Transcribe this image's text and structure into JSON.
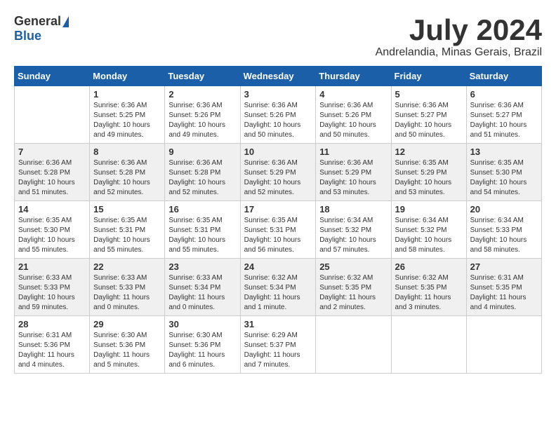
{
  "header": {
    "logo_general": "General",
    "logo_blue": "Blue",
    "month_title": "July 2024",
    "location": "Andrelandia, Minas Gerais, Brazil"
  },
  "weekdays": [
    "Sunday",
    "Monday",
    "Tuesday",
    "Wednesday",
    "Thursday",
    "Friday",
    "Saturday"
  ],
  "weeks": [
    [
      {
        "day": "",
        "sunrise": "",
        "sunset": "",
        "daylight": ""
      },
      {
        "day": "1",
        "sunrise": "Sunrise: 6:36 AM",
        "sunset": "Sunset: 5:25 PM",
        "daylight": "Daylight: 10 hours and 49 minutes."
      },
      {
        "day": "2",
        "sunrise": "Sunrise: 6:36 AM",
        "sunset": "Sunset: 5:26 PM",
        "daylight": "Daylight: 10 hours and 49 minutes."
      },
      {
        "day": "3",
        "sunrise": "Sunrise: 6:36 AM",
        "sunset": "Sunset: 5:26 PM",
        "daylight": "Daylight: 10 hours and 50 minutes."
      },
      {
        "day": "4",
        "sunrise": "Sunrise: 6:36 AM",
        "sunset": "Sunset: 5:26 PM",
        "daylight": "Daylight: 10 hours and 50 minutes."
      },
      {
        "day": "5",
        "sunrise": "Sunrise: 6:36 AM",
        "sunset": "Sunset: 5:27 PM",
        "daylight": "Daylight: 10 hours and 50 minutes."
      },
      {
        "day": "6",
        "sunrise": "Sunrise: 6:36 AM",
        "sunset": "Sunset: 5:27 PM",
        "daylight": "Daylight: 10 hours and 51 minutes."
      }
    ],
    [
      {
        "day": "7",
        "sunrise": "Sunrise: 6:36 AM",
        "sunset": "Sunset: 5:28 PM",
        "daylight": "Daylight: 10 hours and 51 minutes."
      },
      {
        "day": "8",
        "sunrise": "Sunrise: 6:36 AM",
        "sunset": "Sunset: 5:28 PM",
        "daylight": "Daylight: 10 hours and 52 minutes."
      },
      {
        "day": "9",
        "sunrise": "Sunrise: 6:36 AM",
        "sunset": "Sunset: 5:28 PM",
        "daylight": "Daylight: 10 hours and 52 minutes."
      },
      {
        "day": "10",
        "sunrise": "Sunrise: 6:36 AM",
        "sunset": "Sunset: 5:29 PM",
        "daylight": "Daylight: 10 hours and 52 minutes."
      },
      {
        "day": "11",
        "sunrise": "Sunrise: 6:36 AM",
        "sunset": "Sunset: 5:29 PM",
        "daylight": "Daylight: 10 hours and 53 minutes."
      },
      {
        "day": "12",
        "sunrise": "Sunrise: 6:35 AM",
        "sunset": "Sunset: 5:29 PM",
        "daylight": "Daylight: 10 hours and 53 minutes."
      },
      {
        "day": "13",
        "sunrise": "Sunrise: 6:35 AM",
        "sunset": "Sunset: 5:30 PM",
        "daylight": "Daylight: 10 hours and 54 minutes."
      }
    ],
    [
      {
        "day": "14",
        "sunrise": "Sunrise: 6:35 AM",
        "sunset": "Sunset: 5:30 PM",
        "daylight": "Daylight: 10 hours and 55 minutes."
      },
      {
        "day": "15",
        "sunrise": "Sunrise: 6:35 AM",
        "sunset": "Sunset: 5:31 PM",
        "daylight": "Daylight: 10 hours and 55 minutes."
      },
      {
        "day": "16",
        "sunrise": "Sunrise: 6:35 AM",
        "sunset": "Sunset: 5:31 PM",
        "daylight": "Daylight: 10 hours and 55 minutes."
      },
      {
        "day": "17",
        "sunrise": "Sunrise: 6:35 AM",
        "sunset": "Sunset: 5:31 PM",
        "daylight": "Daylight: 10 hours and 56 minutes."
      },
      {
        "day": "18",
        "sunrise": "Sunrise: 6:34 AM",
        "sunset": "Sunset: 5:32 PM",
        "daylight": "Daylight: 10 hours and 57 minutes."
      },
      {
        "day": "19",
        "sunrise": "Sunrise: 6:34 AM",
        "sunset": "Sunset: 5:32 PM",
        "daylight": "Daylight: 10 hours and 58 minutes."
      },
      {
        "day": "20",
        "sunrise": "Sunrise: 6:34 AM",
        "sunset": "Sunset: 5:33 PM",
        "daylight": "Daylight: 10 hours and 58 minutes."
      }
    ],
    [
      {
        "day": "21",
        "sunrise": "Sunrise: 6:33 AM",
        "sunset": "Sunset: 5:33 PM",
        "daylight": "Daylight: 10 hours and 59 minutes."
      },
      {
        "day": "22",
        "sunrise": "Sunrise: 6:33 AM",
        "sunset": "Sunset: 5:33 PM",
        "daylight": "Daylight: 11 hours and 0 minutes."
      },
      {
        "day": "23",
        "sunrise": "Sunrise: 6:33 AM",
        "sunset": "Sunset: 5:34 PM",
        "daylight": "Daylight: 11 hours and 0 minutes."
      },
      {
        "day": "24",
        "sunrise": "Sunrise: 6:32 AM",
        "sunset": "Sunset: 5:34 PM",
        "daylight": "Daylight: 11 hours and 1 minute."
      },
      {
        "day": "25",
        "sunrise": "Sunrise: 6:32 AM",
        "sunset": "Sunset: 5:35 PM",
        "daylight": "Daylight: 11 hours and 2 minutes."
      },
      {
        "day": "26",
        "sunrise": "Sunrise: 6:32 AM",
        "sunset": "Sunset: 5:35 PM",
        "daylight": "Daylight: 11 hours and 3 minutes."
      },
      {
        "day": "27",
        "sunrise": "Sunrise: 6:31 AM",
        "sunset": "Sunset: 5:35 PM",
        "daylight": "Daylight: 11 hours and 4 minutes."
      }
    ],
    [
      {
        "day": "28",
        "sunrise": "Sunrise: 6:31 AM",
        "sunset": "Sunset: 5:36 PM",
        "daylight": "Daylight: 11 hours and 4 minutes."
      },
      {
        "day": "29",
        "sunrise": "Sunrise: 6:30 AM",
        "sunset": "Sunset: 5:36 PM",
        "daylight": "Daylight: 11 hours and 5 minutes."
      },
      {
        "day": "30",
        "sunrise": "Sunrise: 6:30 AM",
        "sunset": "Sunset: 5:36 PM",
        "daylight": "Daylight: 11 hours and 6 minutes."
      },
      {
        "day": "31",
        "sunrise": "Sunrise: 6:29 AM",
        "sunset": "Sunset: 5:37 PM",
        "daylight": "Daylight: 11 hours and 7 minutes."
      },
      {
        "day": "",
        "sunrise": "",
        "sunset": "",
        "daylight": ""
      },
      {
        "day": "",
        "sunrise": "",
        "sunset": "",
        "daylight": ""
      },
      {
        "day": "",
        "sunrise": "",
        "sunset": "",
        "daylight": ""
      }
    ]
  ]
}
